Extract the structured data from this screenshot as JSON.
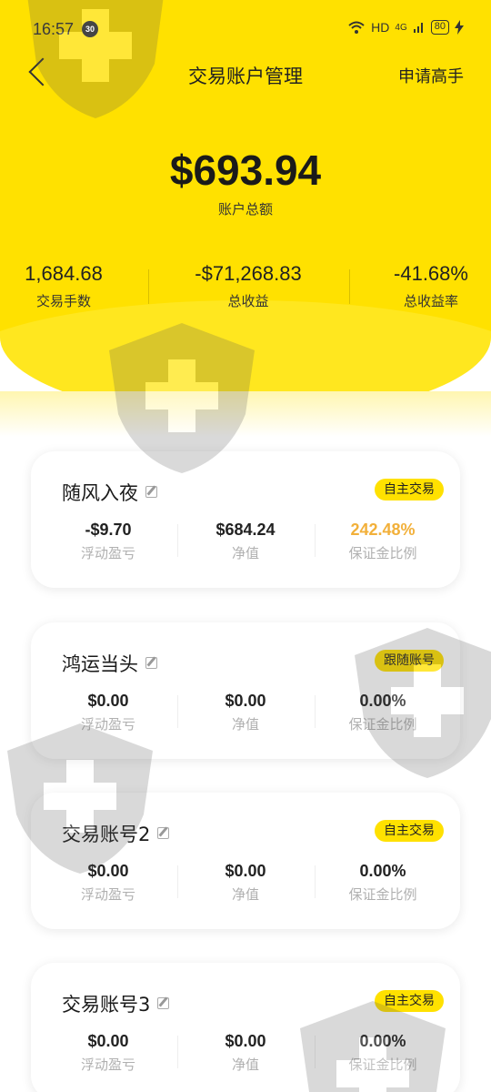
{
  "status_bar": {
    "time": "16:57",
    "notification_count": "30",
    "network": "HD",
    "signal": "4G",
    "battery": "80"
  },
  "header": {
    "title": "交易账户管理",
    "action_label": "申请高手"
  },
  "summary": {
    "total_amount": "$693.94",
    "total_label": "账户总额",
    "stats": [
      {
        "value": "1,684.68",
        "label": "交易手数"
      },
      {
        "value": "-$71,268.83",
        "label": "总收益"
      },
      {
        "value": "-41.68%",
        "label": "总收益率"
      }
    ]
  },
  "accounts": [
    {
      "name": "随风入夜",
      "tag": "自主交易",
      "metrics": [
        {
          "value": "-$9.70",
          "label": "浮动盈亏"
        },
        {
          "value": "$684.24",
          "label": "净值"
        },
        {
          "value": "242.48%",
          "label": "保证金比例"
        }
      ]
    },
    {
      "name": "鸿运当头",
      "tag": "跟随账号",
      "metrics": [
        {
          "value": "$0.00",
          "label": "浮动盈亏"
        },
        {
          "value": "$0.00",
          "label": "净值"
        },
        {
          "value": "0.00%",
          "label": "保证金比例"
        }
      ]
    },
    {
      "name": "交易账号2",
      "tag": "自主交易",
      "metrics": [
        {
          "value": "$0.00",
          "label": "浮动盈亏"
        },
        {
          "value": "$0.00",
          "label": "净值"
        },
        {
          "value": "0.00%",
          "label": "保证金比例"
        }
      ]
    },
    {
      "name": "交易账号3",
      "tag": "自主交易",
      "metrics": [
        {
          "value": "$0.00",
          "label": "浮动盈亏"
        },
        {
          "value": "$0.00",
          "label": "净值"
        },
        {
          "value": "0.00%",
          "label": "保证金比例"
        }
      ]
    }
  ],
  "colors": {
    "brand_yellow": "#ffe100",
    "highlight_orange": "#f2b03a"
  }
}
